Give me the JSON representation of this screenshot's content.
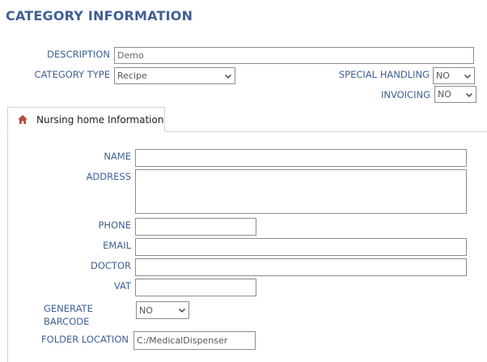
{
  "page": {
    "title": "CATEGORY INFORMATION"
  },
  "category": {
    "description_label": "DESCRIPTION",
    "description_value": "Demo",
    "category_type_label": "CATEGORY TYPE",
    "category_type_value": "Recipe",
    "special_handling_label": "SPECIAL HANDLING",
    "special_handling_value": "NO",
    "invoicing_label": "INVOICING",
    "invoicing_value": "NO"
  },
  "tabs": [
    {
      "label": "Nursing home Information",
      "icon": "home-icon",
      "icon_color": "#b84a3a",
      "active": true
    }
  ],
  "nursing_home": {
    "name_label": "NAME",
    "name_value": "",
    "address_label": "ADDRESS",
    "address_value": "",
    "phone_label": "PHONE",
    "phone_value": "",
    "email_label": "EMAIL",
    "email_value": "",
    "doctor_label": "DOCTOR",
    "doctor_value": "",
    "vat_label": "VAT",
    "vat_value": "",
    "generate_barcode_label_line1": "GENERATE",
    "generate_barcode_label_line2": "BARCODE",
    "generate_barcode_value": "NO",
    "folder_location_label": "FOLDER LOCATION",
    "folder_location_value": "C:/MedicalDispenser"
  },
  "colors": {
    "label": "#3f5f95",
    "border": "#8c8c8c",
    "tab_border": "#d2d2d2"
  }
}
